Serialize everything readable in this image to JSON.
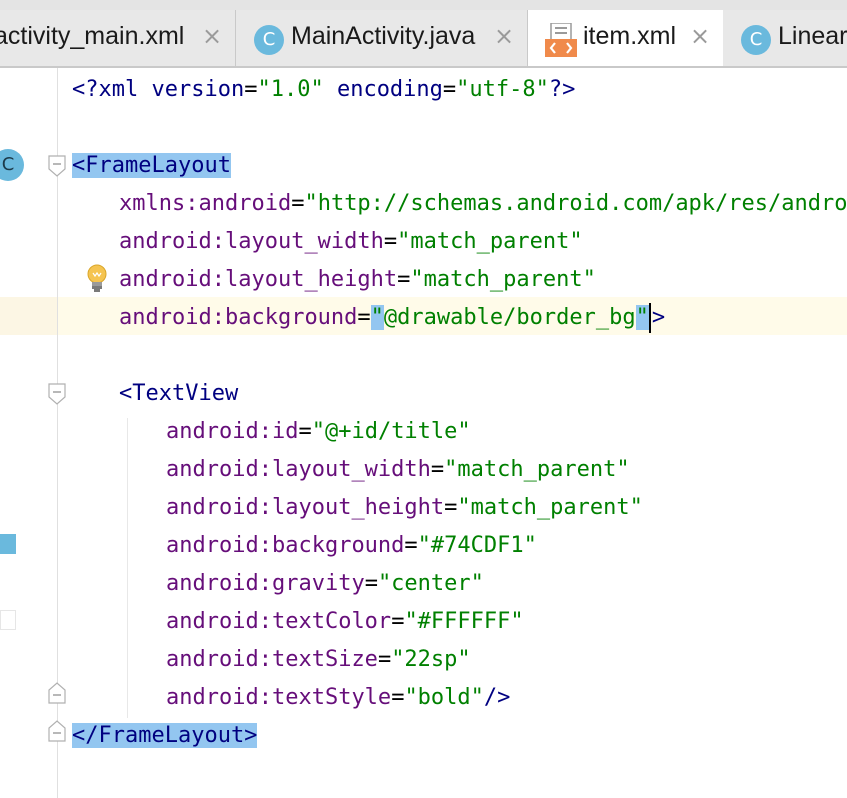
{
  "tabs": [
    {
      "label": "activity_main.xml",
      "icon": "xml-file-icon"
    },
    {
      "label": "MainActivity.java",
      "icon": "java-class-icon"
    },
    {
      "label": "item.xml",
      "icon": "xml-layout-icon",
      "active": true
    },
    {
      "label": "Linear",
      "icon": "java-class-icon"
    }
  ],
  "tab_close_glyph": "×",
  "class_icon_letter": "C",
  "editor": {
    "prolog": {
      "open": "<?",
      "name": "xml",
      "a1": "version",
      "eq1": "=",
      "v1": "\"1.0\"",
      "a2": "encoding",
      "eq2": "=",
      "v2": "\"utf-8\"",
      "close": "?>"
    },
    "frame_open": "<FrameLayout",
    "xmlns_ns": "xmlns:",
    "xmlns_attr": "android",
    "xmlns_eq": "=",
    "xmlns_val": "\"http://schemas.android.com/apk/res/android\"",
    "fl_attrs": [
      {
        "ns": "android:",
        "name": "layout_width",
        "eq": "=",
        "val": "\"match_parent\""
      },
      {
        "ns": "android:",
        "name": "layout_height",
        "eq": "=",
        "val": "\"match_parent\""
      }
    ],
    "bg_ns": "android:",
    "bg_name": "background",
    "bg_eq": "=",
    "bg_q1": "\"",
    "bg_val": "@drawable/border_bg",
    "bg_q2": "\"",
    "bg_end": ">",
    "textview_open": "<TextView",
    "tv_attrs": [
      {
        "ns": "android:",
        "name": "id",
        "eq": "=",
        "val": "\"@+id/title\""
      },
      {
        "ns": "android:",
        "name": "layout_width",
        "eq": "=",
        "val": "\"match_parent\""
      },
      {
        "ns": "android:",
        "name": "layout_height",
        "eq": "=",
        "val": "\"match_parent\""
      },
      {
        "ns": "android:",
        "name": "background",
        "eq": "=",
        "val": "\"#74CDF1\""
      },
      {
        "ns": "android:",
        "name": "gravity",
        "eq": "=",
        "val": "\"center\""
      },
      {
        "ns": "android:",
        "name": "textColor",
        "eq": "=",
        "val": "\"#FFFFFF\""
      },
      {
        "ns": "android:",
        "name": "textSize",
        "eq": "=",
        "val": "\"22sp\""
      }
    ],
    "ts_ns": "android:",
    "ts_name": "textStyle",
    "ts_eq": "=",
    "ts_val": "\"bold\"",
    "ts_end": "/>",
    "frame_close": "</FrameLayout>"
  },
  "colors": {
    "tag": "#000080",
    "attribute": "#660e7a",
    "string": "#008000",
    "selection": "#93c6f0",
    "caret_row": "#fffbe9",
    "class_icon": "#6ab9dd"
  }
}
